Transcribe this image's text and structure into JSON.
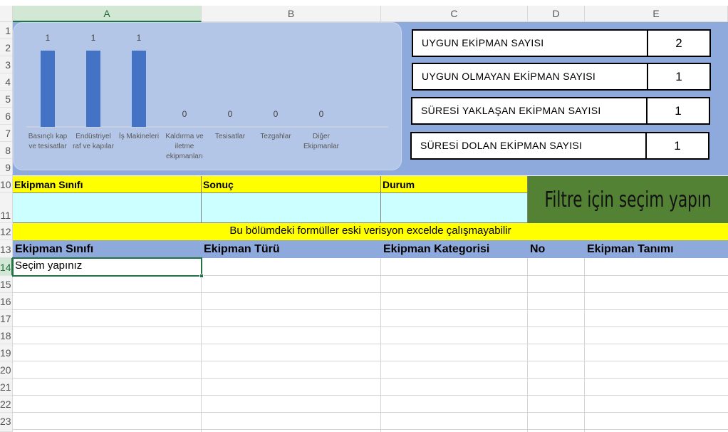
{
  "columns": [
    "A",
    "B",
    "C",
    "D",
    "E"
  ],
  "rows": [
    "1",
    "2",
    "3",
    "4",
    "5",
    "6",
    "7",
    "8",
    "9",
    "10",
    "11",
    "12",
    "13",
    "14",
    "15",
    "16",
    "17",
    "18",
    "19",
    "20",
    "21",
    "22",
    "23"
  ],
  "chart_data": {
    "type": "bar",
    "categories": [
      "Basınçlı kap ve tesisatlar",
      "Endüstriyel raf ve kapılar",
      "İş Makineleri",
      "Kaldırma ve iletme ekipmanları",
      "Tesisatlar",
      "Tezgahlar",
      "Diğer Ekipmanlar"
    ],
    "category_lines": [
      [
        "Basınçlı kap",
        "ve tesisatlar"
      ],
      [
        "Endüstriyel",
        "raf ve kapılar"
      ],
      [
        "İş Makineleri"
      ],
      [
        "Kaldırma ve",
        "iletme",
        "ekipmanları"
      ],
      [
        "Tesisatlar"
      ],
      [
        "Tezgahlar"
      ],
      [
        "Diğer",
        "Ekipmanlar"
      ]
    ],
    "values": [
      1,
      1,
      1,
      0,
      0,
      0,
      0
    ],
    "value_labels": [
      "1",
      "1",
      "1",
      "0",
      "0",
      "0",
      "0"
    ],
    "ylim": [
      0,
      1
    ],
    "bar_color": "#4472c4",
    "title": "",
    "xlabel": "",
    "ylabel": ""
  },
  "stats": [
    {
      "label": "UYGUN EKİPMAN SAYISI",
      "value": "2"
    },
    {
      "label": "UYGUN OLMAYAN EKİPMAN SAYISI",
      "value": "1"
    },
    {
      "label": "SÜRESİ YAKLAŞAN EKİPMAN SAYISI",
      "value": "1"
    },
    {
      "label": "SÜRESİ DOLAN EKİPMAN SAYISI",
      "value": "1"
    }
  ],
  "filter": {
    "headers": [
      "Ekipman Sınıfı",
      "Sonuç",
      "Durum"
    ],
    "values": [
      "",
      "",
      ""
    ],
    "button_label": "Filtre için seçim yapın"
  },
  "warning": "Bu bölümdeki formüller eski verisyon excelde çalışmayabilir",
  "table": {
    "headers": [
      "Ekipman Sınıfı",
      "Ekipman Türü",
      "Ekipman Kategorisi",
      "No",
      "Ekipman Tanımı"
    ],
    "first_row": [
      "Seçim yapınız",
      "",
      "",
      "",
      ""
    ]
  },
  "colors": {
    "dashboard_bg": "#8ea9db",
    "chart_panel": "#b4c6e7",
    "yellow": "#ffff00",
    "cyan": "#ccffff",
    "green_button": "#548235",
    "excel_green": "#217346"
  }
}
